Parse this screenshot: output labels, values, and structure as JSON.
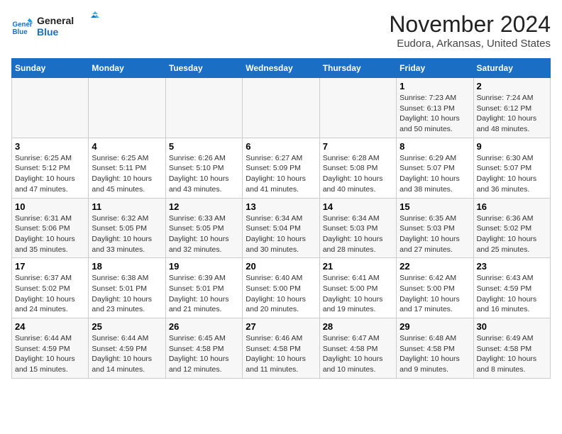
{
  "logo": {
    "line1": "General",
    "line2": "Blue"
  },
  "title": "November 2024",
  "subtitle": "Eudora, Arkansas, United States",
  "days_of_week": [
    "Sunday",
    "Monday",
    "Tuesday",
    "Wednesday",
    "Thursday",
    "Friday",
    "Saturday"
  ],
  "weeks": [
    [
      {
        "day": "",
        "detail": ""
      },
      {
        "day": "",
        "detail": ""
      },
      {
        "day": "",
        "detail": ""
      },
      {
        "day": "",
        "detail": ""
      },
      {
        "day": "",
        "detail": ""
      },
      {
        "day": "1",
        "detail": "Sunrise: 7:23 AM\nSunset: 6:13 PM\nDaylight: 10 hours\nand 50 minutes."
      },
      {
        "day": "2",
        "detail": "Sunrise: 7:24 AM\nSunset: 6:12 PM\nDaylight: 10 hours\nand 48 minutes."
      }
    ],
    [
      {
        "day": "3",
        "detail": "Sunrise: 6:25 AM\nSunset: 5:12 PM\nDaylight: 10 hours\nand 47 minutes."
      },
      {
        "day": "4",
        "detail": "Sunrise: 6:25 AM\nSunset: 5:11 PM\nDaylight: 10 hours\nand 45 minutes."
      },
      {
        "day": "5",
        "detail": "Sunrise: 6:26 AM\nSunset: 5:10 PM\nDaylight: 10 hours\nand 43 minutes."
      },
      {
        "day": "6",
        "detail": "Sunrise: 6:27 AM\nSunset: 5:09 PM\nDaylight: 10 hours\nand 41 minutes."
      },
      {
        "day": "7",
        "detail": "Sunrise: 6:28 AM\nSunset: 5:08 PM\nDaylight: 10 hours\nand 40 minutes."
      },
      {
        "day": "8",
        "detail": "Sunrise: 6:29 AM\nSunset: 5:07 PM\nDaylight: 10 hours\nand 38 minutes."
      },
      {
        "day": "9",
        "detail": "Sunrise: 6:30 AM\nSunset: 5:07 PM\nDaylight: 10 hours\nand 36 minutes."
      }
    ],
    [
      {
        "day": "10",
        "detail": "Sunrise: 6:31 AM\nSunset: 5:06 PM\nDaylight: 10 hours\nand 35 minutes."
      },
      {
        "day": "11",
        "detail": "Sunrise: 6:32 AM\nSunset: 5:05 PM\nDaylight: 10 hours\nand 33 minutes."
      },
      {
        "day": "12",
        "detail": "Sunrise: 6:33 AM\nSunset: 5:05 PM\nDaylight: 10 hours\nand 32 minutes."
      },
      {
        "day": "13",
        "detail": "Sunrise: 6:34 AM\nSunset: 5:04 PM\nDaylight: 10 hours\nand 30 minutes."
      },
      {
        "day": "14",
        "detail": "Sunrise: 6:34 AM\nSunset: 5:03 PM\nDaylight: 10 hours\nand 28 minutes."
      },
      {
        "day": "15",
        "detail": "Sunrise: 6:35 AM\nSunset: 5:03 PM\nDaylight: 10 hours\nand 27 minutes."
      },
      {
        "day": "16",
        "detail": "Sunrise: 6:36 AM\nSunset: 5:02 PM\nDaylight: 10 hours\nand 25 minutes."
      }
    ],
    [
      {
        "day": "17",
        "detail": "Sunrise: 6:37 AM\nSunset: 5:02 PM\nDaylight: 10 hours\nand 24 minutes."
      },
      {
        "day": "18",
        "detail": "Sunrise: 6:38 AM\nSunset: 5:01 PM\nDaylight: 10 hours\nand 23 minutes."
      },
      {
        "day": "19",
        "detail": "Sunrise: 6:39 AM\nSunset: 5:01 PM\nDaylight: 10 hours\nand 21 minutes."
      },
      {
        "day": "20",
        "detail": "Sunrise: 6:40 AM\nSunset: 5:00 PM\nDaylight: 10 hours\nand 20 minutes."
      },
      {
        "day": "21",
        "detail": "Sunrise: 6:41 AM\nSunset: 5:00 PM\nDaylight: 10 hours\nand 19 minutes."
      },
      {
        "day": "22",
        "detail": "Sunrise: 6:42 AM\nSunset: 5:00 PM\nDaylight: 10 hours\nand 17 minutes."
      },
      {
        "day": "23",
        "detail": "Sunrise: 6:43 AM\nSunset: 4:59 PM\nDaylight: 10 hours\nand 16 minutes."
      }
    ],
    [
      {
        "day": "24",
        "detail": "Sunrise: 6:44 AM\nSunset: 4:59 PM\nDaylight: 10 hours\nand 15 minutes."
      },
      {
        "day": "25",
        "detail": "Sunrise: 6:44 AM\nSunset: 4:59 PM\nDaylight: 10 hours\nand 14 minutes."
      },
      {
        "day": "26",
        "detail": "Sunrise: 6:45 AM\nSunset: 4:58 PM\nDaylight: 10 hours\nand 12 minutes."
      },
      {
        "day": "27",
        "detail": "Sunrise: 6:46 AM\nSunset: 4:58 PM\nDaylight: 10 hours\nand 11 minutes."
      },
      {
        "day": "28",
        "detail": "Sunrise: 6:47 AM\nSunset: 4:58 PM\nDaylight: 10 hours\nand 10 minutes."
      },
      {
        "day": "29",
        "detail": "Sunrise: 6:48 AM\nSunset: 4:58 PM\nDaylight: 10 hours\nand 9 minutes."
      },
      {
        "day": "30",
        "detail": "Sunrise: 6:49 AM\nSunset: 4:58 PM\nDaylight: 10 hours\nand 8 minutes."
      }
    ]
  ]
}
